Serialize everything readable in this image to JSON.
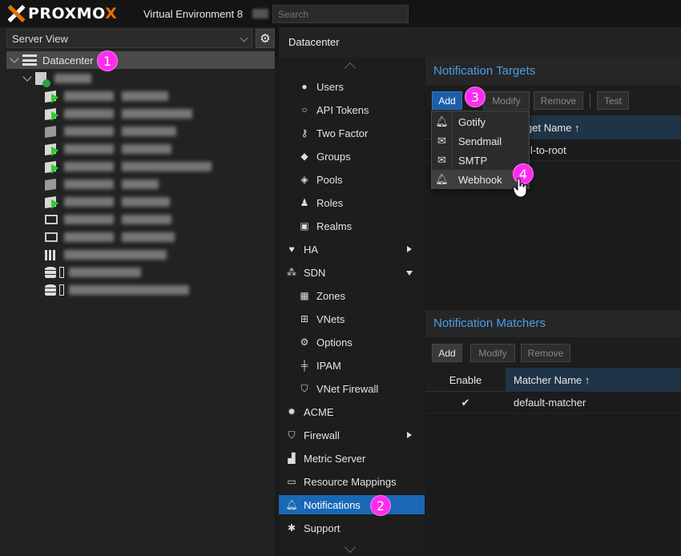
{
  "header": {
    "logo_text_a": "PROXMO",
    "logo_text_b": "X",
    "product": "Virtual Environment 8",
    "search_placeholder": "Search"
  },
  "left": {
    "view_label": "Server View",
    "datacenter": "Datacenter"
  },
  "breadcrumb": "Datacenter",
  "menu": {
    "users": "Users",
    "api_tokens": "API Tokens",
    "two_factor": "Two Factor",
    "groups": "Groups",
    "pools": "Pools",
    "roles": "Roles",
    "realms": "Realms",
    "ha": "HA",
    "sdn": "SDN",
    "zones": "Zones",
    "vnets": "VNets",
    "options": "Options",
    "ipam": "IPAM",
    "vnet_firewall": "VNet Firewall",
    "acme": "ACME",
    "firewall": "Firewall",
    "metric_server": "Metric Server",
    "resource_mappings": "Resource Mappings",
    "notifications": "Notifications",
    "support": "Support"
  },
  "targets": {
    "title": "Notification Targets",
    "add": "Add",
    "modify": "Modify",
    "remove": "Remove",
    "test": "Test",
    "col_name": "Target Name ↑",
    "row1": "mail-to-root"
  },
  "add_menu": {
    "gotify": "Gotify",
    "sendmail": "Sendmail",
    "smtp": "SMTP",
    "webhook": "Webhook"
  },
  "matchers": {
    "title": "Notification Matchers",
    "add": "Add",
    "modify": "Modify",
    "remove": "Remove",
    "col_enable": "Enable",
    "col_name": "Matcher Name ↑",
    "row1_check": "✔",
    "row1_name": "default-matcher"
  },
  "badges": {
    "b1": "1",
    "b2": "2",
    "b3": "3",
    "b4": "4"
  },
  "colors": {
    "accent": "#1868b5",
    "title_blue": "#4a9ee8",
    "badge": "#ff2cf0",
    "brand_orange": "#e57000"
  }
}
